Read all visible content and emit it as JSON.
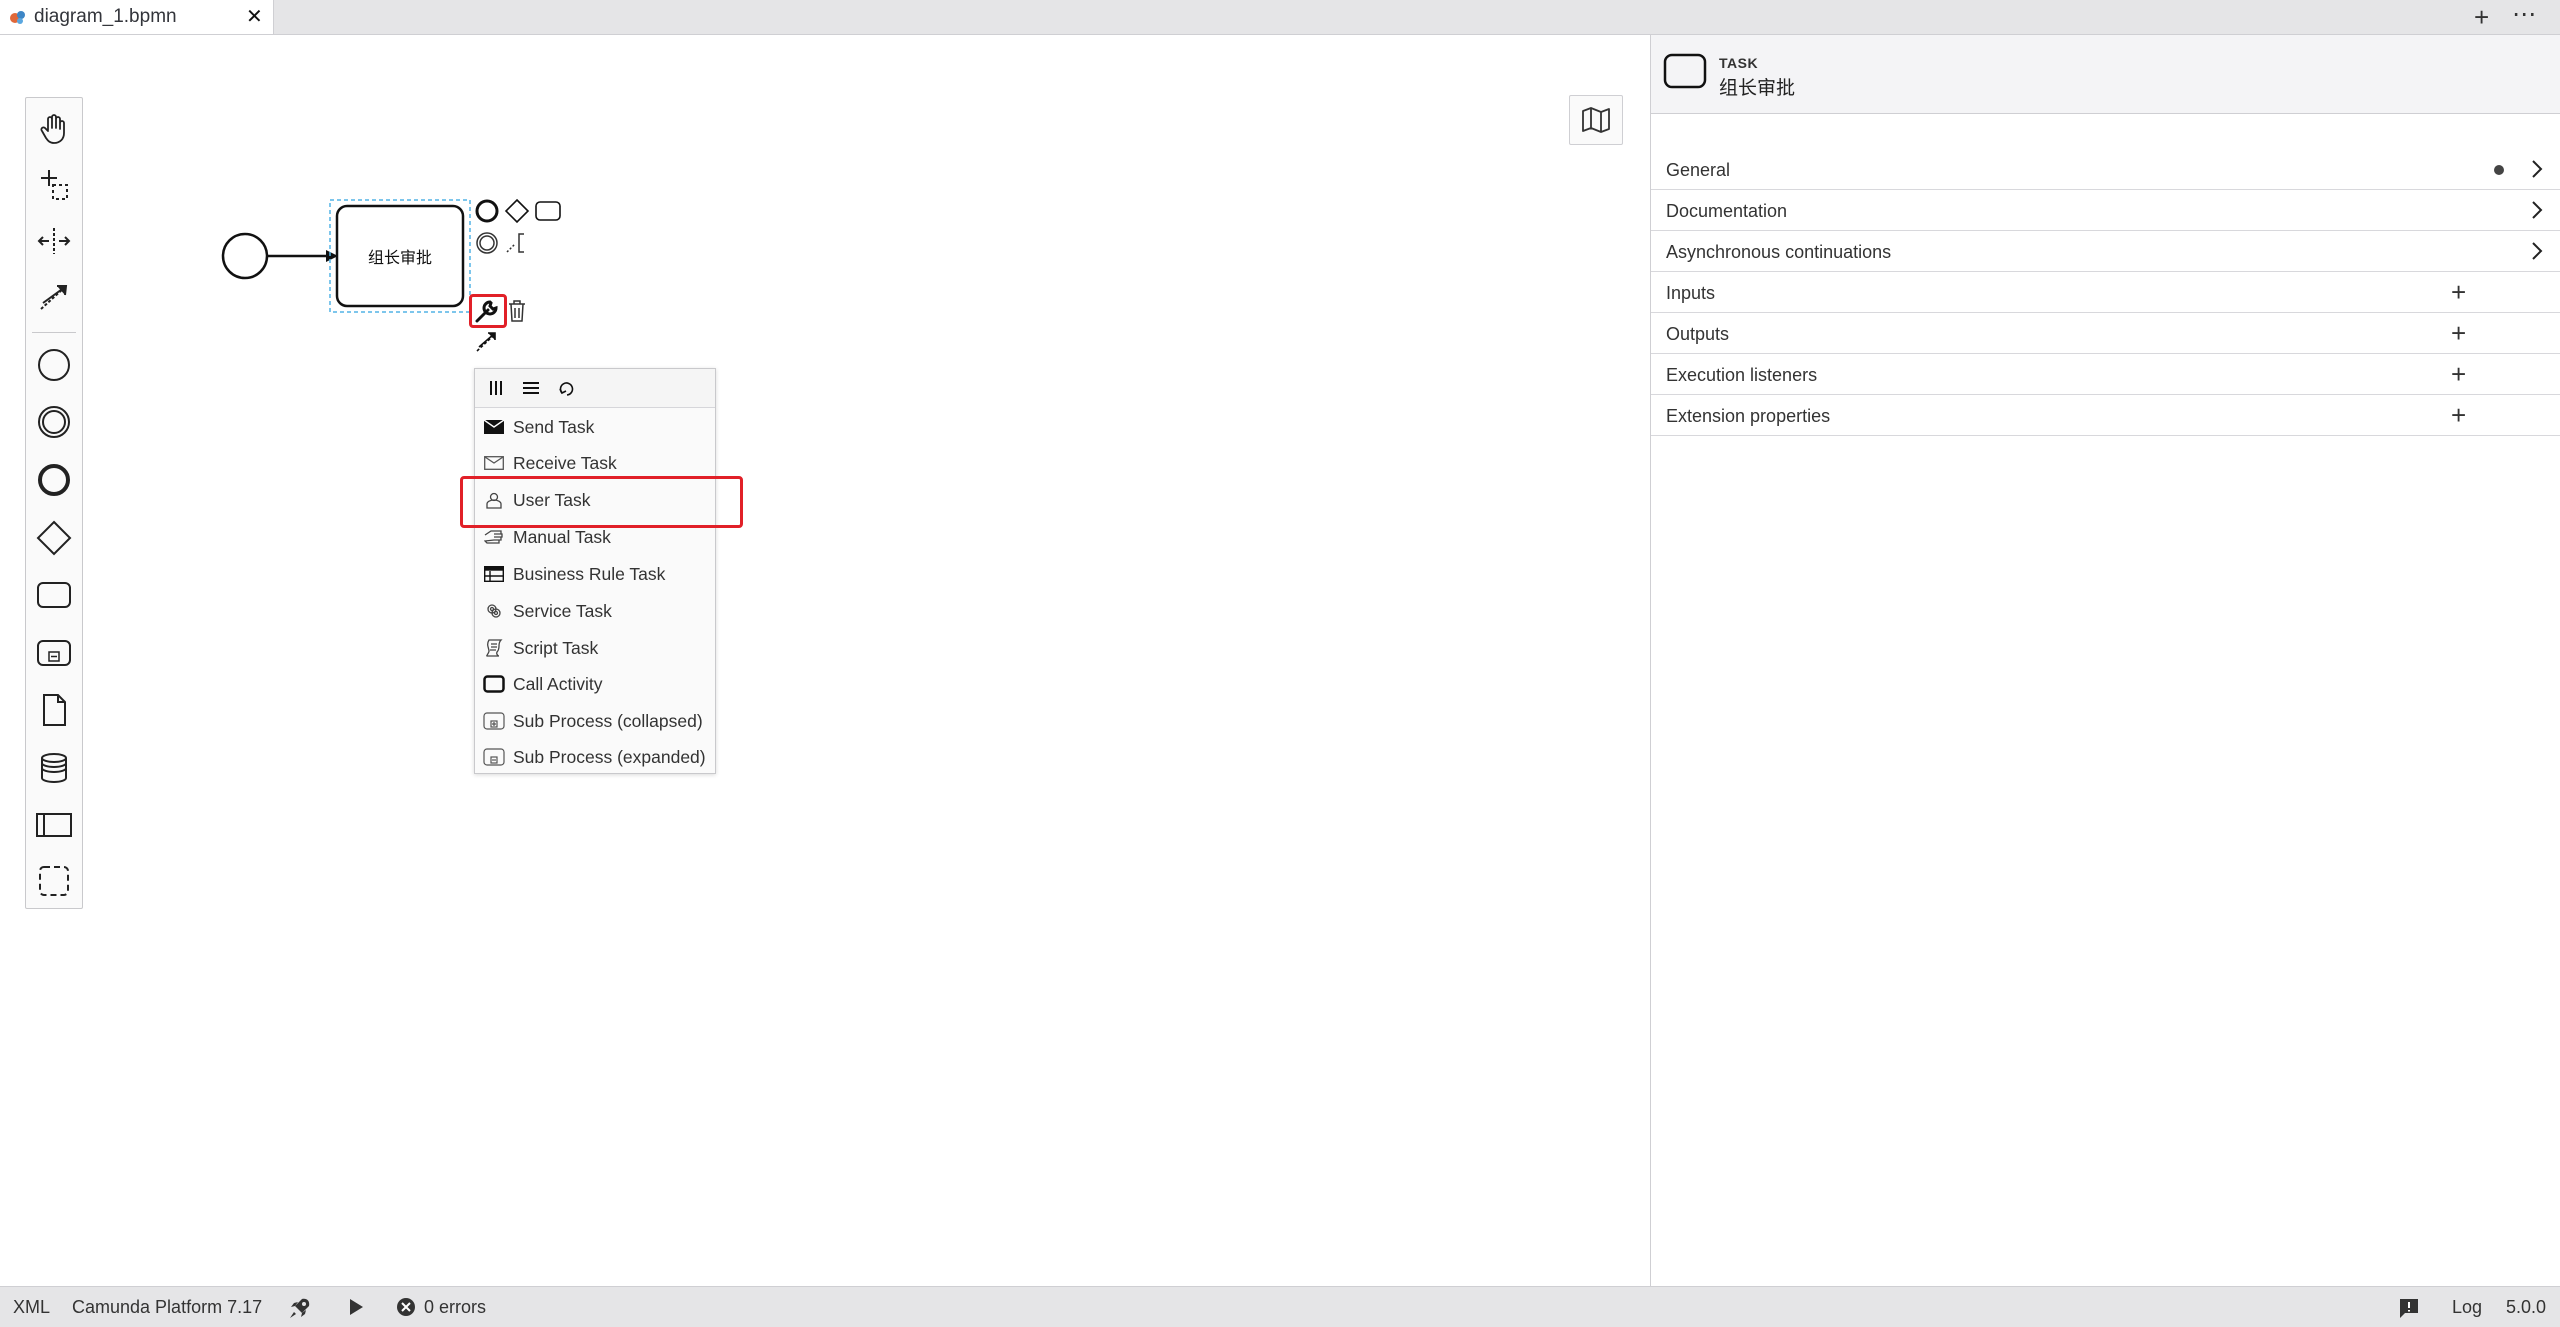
{
  "tab": {
    "title": "diagram_1.bpmn",
    "close_label": "✕",
    "add_label": "+",
    "more_label": "⋯"
  },
  "diagram": {
    "task_name": "组长审批"
  },
  "replace_menu": {
    "entries": [
      {
        "label": "Send Task",
        "icon": "send-task-icon"
      },
      {
        "label": "Receive Task",
        "icon": "receive-task-icon"
      },
      {
        "label": "User Task",
        "icon": "user-task-icon"
      },
      {
        "label": "Manual Task",
        "icon": "manual-task-icon"
      },
      {
        "label": "Business Rule Task",
        "icon": "business-rule-task-icon"
      },
      {
        "label": "Service Task",
        "icon": "service-task-icon"
      },
      {
        "label": "Script Task",
        "icon": "script-task-icon"
      },
      {
        "label": "Call Activity",
        "icon": "call-activity-icon"
      },
      {
        "label": "Sub Process (collapsed)",
        "icon": "subprocess-collapsed-icon"
      },
      {
        "label": "Sub Process (expanded)",
        "icon": "subprocess-expanded-icon"
      }
    ]
  },
  "properties": {
    "type": "TASK",
    "name": "组长审批",
    "groups": [
      {
        "label": "General",
        "control": "chevron",
        "has_dot": true
      },
      {
        "label": "Documentation",
        "control": "chevron"
      },
      {
        "label": "Asynchronous continuations",
        "control": "chevron"
      },
      {
        "label": "Inputs",
        "control": "plus"
      },
      {
        "label": "Outputs",
        "control": "plus"
      },
      {
        "label": "Execution listeners",
        "control": "plus"
      },
      {
        "label": "Extension properties",
        "control": "plus"
      }
    ]
  },
  "statusbar": {
    "xml_label": "XML",
    "platform": "Camunda Platform 7.17",
    "errors": "0 errors",
    "log_label": "Log",
    "version": "5.0.0"
  },
  "colors": {
    "highlight": "#e12028",
    "selection": "#52b4e6"
  }
}
